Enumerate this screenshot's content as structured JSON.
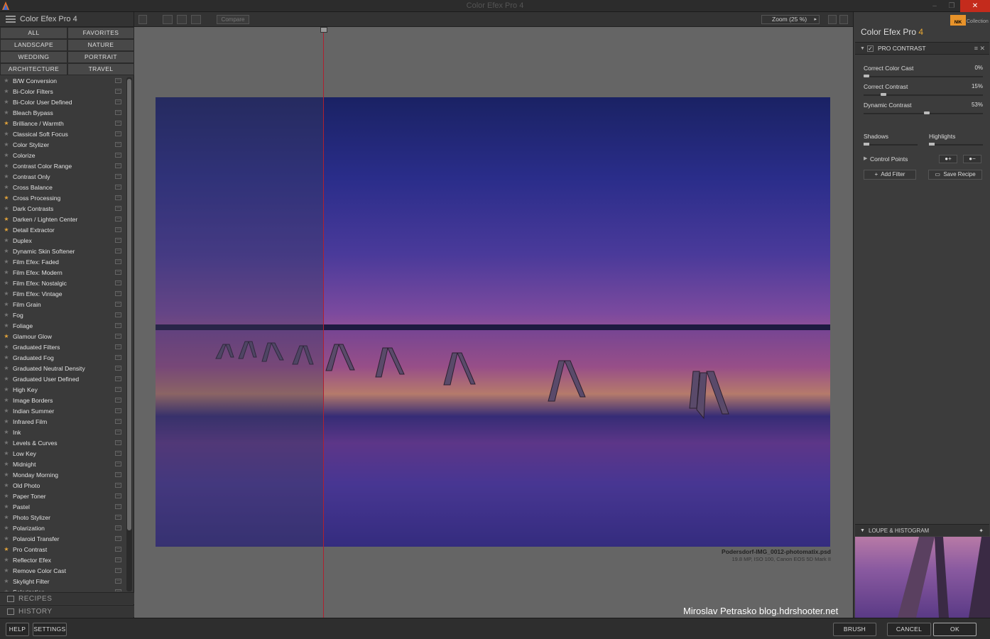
{
  "window": {
    "title": "Color Efex Pro 4",
    "controls": [
      "–",
      "❐",
      "✕"
    ]
  },
  "left_panel": {
    "title": "Color Efex Pro 4",
    "categories": [
      "ALL",
      "FAVORITES",
      "LANDSCAPE",
      "NATURE",
      "WEDDING",
      "PORTRAIT",
      "ARCHITECTURE",
      "TRAVEL"
    ],
    "filters": [
      {
        "name": "B/W Conversion",
        "fav": false
      },
      {
        "name": "Bi-Color Filters",
        "fav": false
      },
      {
        "name": "Bi-Color User Defined",
        "fav": false
      },
      {
        "name": "Bleach Bypass",
        "fav": false
      },
      {
        "name": "Brilliance / Warmth",
        "fav": true
      },
      {
        "name": "Classical Soft Focus",
        "fav": false
      },
      {
        "name": "Color Stylizer",
        "fav": false
      },
      {
        "name": "Colorize",
        "fav": false
      },
      {
        "name": "Contrast Color Range",
        "fav": false
      },
      {
        "name": "Contrast Only",
        "fav": false
      },
      {
        "name": "Cross Balance",
        "fav": false
      },
      {
        "name": "Cross Processing",
        "fav": true
      },
      {
        "name": "Dark Contrasts",
        "fav": false
      },
      {
        "name": "Darken / Lighten Center",
        "fav": true
      },
      {
        "name": "Detail Extractor",
        "fav": true
      },
      {
        "name": "Duplex",
        "fav": false
      },
      {
        "name": "Dynamic Skin Softener",
        "fav": false
      },
      {
        "name": "Film Efex: Faded",
        "fav": false
      },
      {
        "name": "Film Efex: Modern",
        "fav": false
      },
      {
        "name": "Film Efex: Nostalgic",
        "fav": false
      },
      {
        "name": "Film Efex: Vintage",
        "fav": false
      },
      {
        "name": "Film Grain",
        "fav": false
      },
      {
        "name": "Fog",
        "fav": false
      },
      {
        "name": "Foliage",
        "fav": false
      },
      {
        "name": "Glamour Glow",
        "fav": true
      },
      {
        "name": "Graduated Filters",
        "fav": false
      },
      {
        "name": "Graduated Fog",
        "fav": false
      },
      {
        "name": "Graduated Neutral Density",
        "fav": false
      },
      {
        "name": "Graduated User Defined",
        "fav": false
      },
      {
        "name": "High Key",
        "fav": false
      },
      {
        "name": "Image Borders",
        "fav": false
      },
      {
        "name": "Indian Summer",
        "fav": false
      },
      {
        "name": "Infrared Film",
        "fav": false
      },
      {
        "name": "Ink",
        "fav": false
      },
      {
        "name": "Levels & Curves",
        "fav": false
      },
      {
        "name": "Low Key",
        "fav": false
      },
      {
        "name": "Midnight",
        "fav": false
      },
      {
        "name": "Monday Morning",
        "fav": false
      },
      {
        "name": "Old Photo",
        "fav": false
      },
      {
        "name": "Paper Toner",
        "fav": false
      },
      {
        "name": "Pastel",
        "fav": false
      },
      {
        "name": "Photo Stylizer",
        "fav": false
      },
      {
        "name": "Polarization",
        "fav": false
      },
      {
        "name": "Polaroid Transfer",
        "fav": false
      },
      {
        "name": "Pro Contrast",
        "fav": true
      },
      {
        "name": "Reflector Efex",
        "fav": false
      },
      {
        "name": "Remove Color Cast",
        "fav": false
      },
      {
        "name": "Skylight Filter",
        "fav": false
      },
      {
        "name": "Solarization",
        "fav": false
      }
    ],
    "recipes_label": "RECIPES",
    "history_label": "HISTORY"
  },
  "toolbar": {
    "compare_label": "Compare",
    "zoom_label": "Zoom (25 %)"
  },
  "canvas": {
    "file_name": "Podersdorf-IMG_0012-photomatix.psd",
    "file_info": "19.8 MP, ISO 100, Canon EOS 5D Mark II",
    "watermark": "Miroslav  Petrasko  blog.hdrshooter.net"
  },
  "right_panel": {
    "title": "Color Efex Pro",
    "title_version": "4",
    "brand": "Collection",
    "brand_logo": "NIK",
    "filter_name": "PRO CONTRAST",
    "sliders": [
      {
        "label": "Correct Color Cast",
        "value": "0%",
        "level": 0.0
      },
      {
        "label": "Correct Contrast",
        "value": "15%",
        "level": 0.15
      },
      {
        "label": "Dynamic Contrast",
        "value": "53%",
        "level": 0.53
      }
    ],
    "shadows_label": "Shadows",
    "highlights_label": "Highlights",
    "control_points_label": "Control Points",
    "add_filter_label": "Add Filter",
    "save_recipe_label": "Save Recipe",
    "loupe_label": "LOUPE & HISTOGRAM",
    "accent_color": "#e8a833"
  },
  "bottom": {
    "help": "HELP",
    "settings": "SETTINGS",
    "brush": "BRUSH",
    "cancel": "CANCEL",
    "ok": "OK"
  }
}
